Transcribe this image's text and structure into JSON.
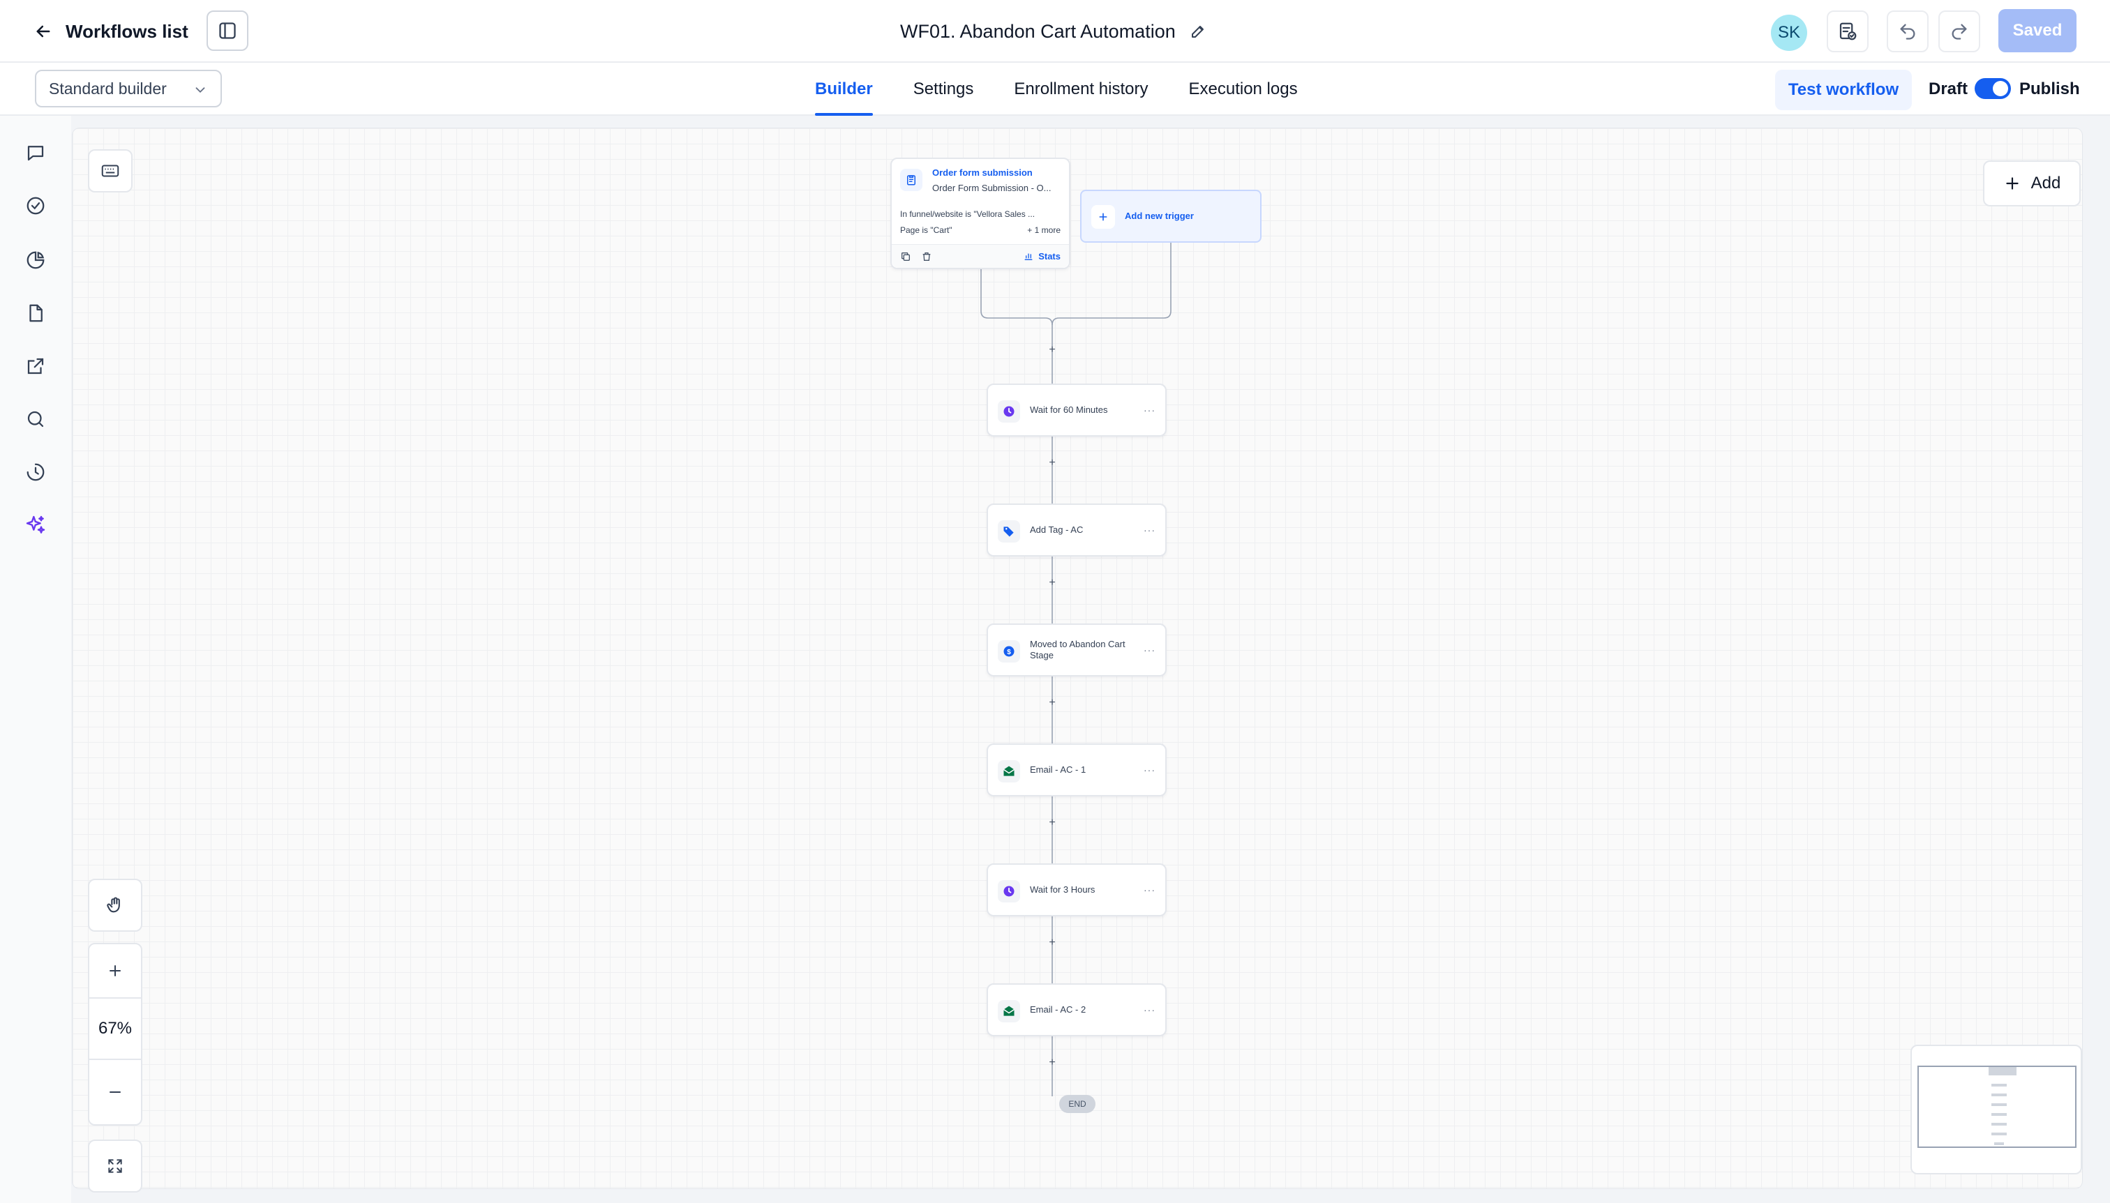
{
  "header": {
    "back_label": "Workflows list",
    "title": "WF01. Abandon Cart Automation",
    "avatar_initials": "SK",
    "saved_label": "Saved"
  },
  "subbar": {
    "builder_select": "Standard builder",
    "tabs": [
      {
        "label": "Builder",
        "active": true
      },
      {
        "label": "Settings",
        "active": false
      },
      {
        "label": "Enrollment history",
        "active": false
      },
      {
        "label": "Execution logs",
        "active": false
      }
    ],
    "test_label": "Test workflow",
    "draft_label": "Draft",
    "publish_label": "Publish"
  },
  "canvas": {
    "add_label": "Add",
    "zoom": "67%",
    "trigger": {
      "title": "Order form submission",
      "subtitle": "Order Form Submission - O...",
      "filter1": "In funnel/website is \"Vellora Sales ...",
      "filter2": "Page is \"Cart\"",
      "more": "+ 1 more",
      "stats": "Stats"
    },
    "add_trigger_label": "Add new trigger",
    "actions": [
      {
        "label": "Wait for 60 Minutes",
        "icon": "clock-icon",
        "color": "#6938ef"
      },
      {
        "label": "Add Tag - AC",
        "icon": "tag-icon",
        "color": "#155eef"
      },
      {
        "label": "Moved to Abandon Cart Stage",
        "icon": "dollar-icon",
        "color": "#155eef"
      },
      {
        "label": "Email - AC - 1",
        "icon": "email-icon",
        "color": "#067647"
      },
      {
        "label": "Wait for 3 Hours",
        "icon": "clock-icon",
        "color": "#6938ef"
      },
      {
        "label": "Email - AC - 2",
        "icon": "email-icon",
        "color": "#067647"
      }
    ],
    "end_label": "END"
  },
  "colors": {
    "accent": "#155eef",
    "saved_bg": "#a4bcf7",
    "avatar_bg": "#a5e8f4"
  }
}
